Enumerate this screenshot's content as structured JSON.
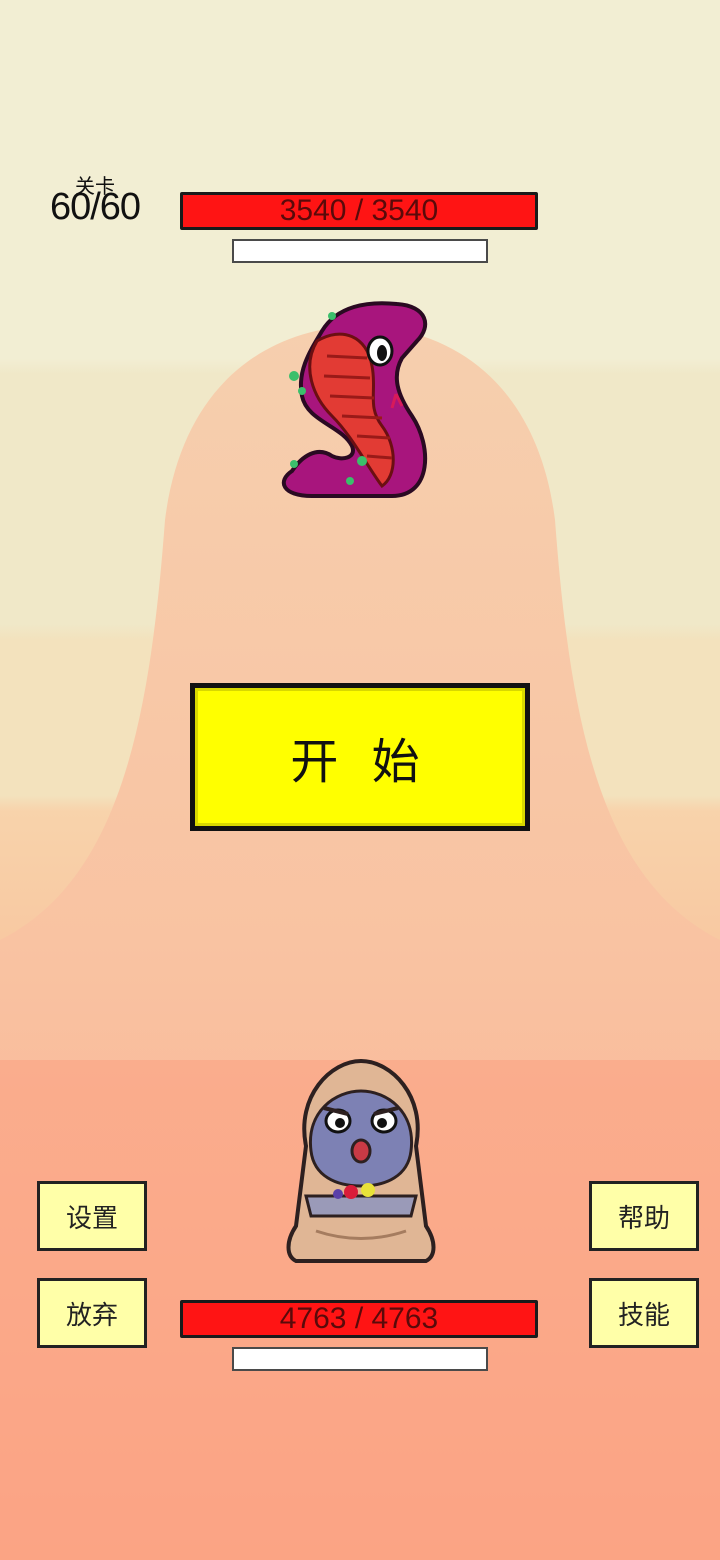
{
  "level": {
    "caption": "关卡",
    "value": "60/60"
  },
  "enemy": {
    "name_icon": "cobra-snake-icon",
    "hp_text": "3540 / 3540",
    "hp_fraction": 1.0,
    "shield_fraction": 0.0
  },
  "player": {
    "name_icon": "hooded-frog-icon",
    "hp_text": "4763 / 4763",
    "hp_fraction": 1.0,
    "shield_fraction": 0.0
  },
  "buttons": {
    "start": "开 始",
    "settings": "设置",
    "give_up": "放弃",
    "help": "帮助",
    "skills": "技能"
  },
  "colors": {
    "hp_bar": "#ff0000",
    "start_button": "#ffff00",
    "side_button": "#ffffa8",
    "sky_top": "#f3efd2",
    "ground": "#f9a585"
  }
}
